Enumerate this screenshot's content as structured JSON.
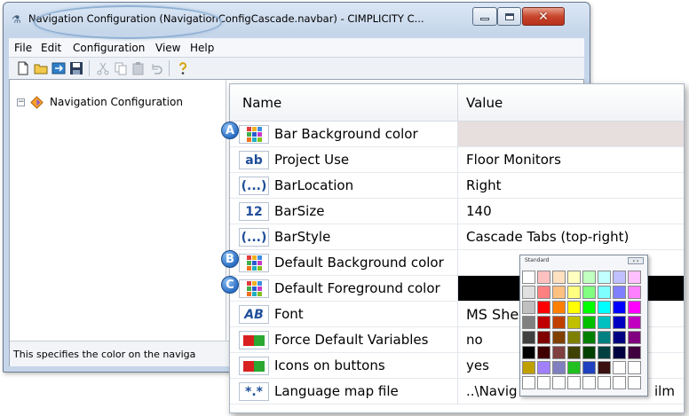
{
  "window": {
    "title": "Navigation Configuration (NavigationConfigCascade.navbar) - CIMPLICITY C...",
    "close_glyph": "✕"
  },
  "menu": [
    "File",
    "Edit",
    "Configuration",
    "View",
    "Help"
  ],
  "tree": {
    "expander": "−",
    "root_label": "Navigation Configuration"
  },
  "status": {
    "text": "This specifies the color on the naviga"
  },
  "grid": {
    "header_name": "Name",
    "header_value": "Value",
    "rows": [
      {
        "badge": "A",
        "icon": "color-grid-icon",
        "name": "Bar Background color",
        "value": "",
        "swatch": "#e7dede"
      },
      {
        "icon": "text-ab-icon",
        "icon_text": "ab",
        "name": "Project Use",
        "value": "Floor Monitors"
      },
      {
        "icon": "ellipsis-icon",
        "icon_text": "(...)",
        "name": "BarLocation",
        "value": "Right"
      },
      {
        "icon": "number-icon",
        "icon_text": "12",
        "name": "BarSize",
        "value": "140"
      },
      {
        "icon": "ellipsis-icon",
        "icon_text": "(...)",
        "name": "BarStyle",
        "value": "Cascade Tabs (top-right)"
      },
      {
        "badge": "B",
        "icon": "color-grid-icon",
        "name": "Default Background color",
        "value": ""
      },
      {
        "badge": "C",
        "icon": "color-grid-icon",
        "name": "Default Foreground color",
        "value": "",
        "swatch": "#000000"
      },
      {
        "icon": "font-icon",
        "icon_text": "AB",
        "name": "Font",
        "value": "MS She"
      },
      {
        "icon": "toggle-icon",
        "name": "Force Default Variables",
        "value": "no"
      },
      {
        "icon": "toggle-icon",
        "name": "Icons on buttons",
        "value": "yes"
      },
      {
        "icon": "file-icon",
        "icon_text": "*.*",
        "name": "Language map file",
        "value": "..\\Navig",
        "value_tail": "ilm"
      }
    ]
  },
  "picker": {
    "title": "Standard",
    "nav": "‹ ›",
    "colors": [
      "#ffffff",
      "#ffc0c0",
      "#ffe0c0",
      "#ffffc0",
      "#c0ffc0",
      "#c0ffff",
      "#c0c0ff",
      "#ffc0ff",
      "#e0e0e0",
      "#ff8080",
      "#ffc080",
      "#ffff80",
      "#80ff80",
      "#80ffff",
      "#8080ff",
      "#ff80ff",
      "#c0c0c0",
      "#ff0000",
      "#ff8000",
      "#ffff00",
      "#00ff00",
      "#00ffff",
      "#0000ff",
      "#ff00ff",
      "#808080",
      "#c00000",
      "#c04000",
      "#c0c000",
      "#00c000",
      "#00c0c0",
      "#0000c0",
      "#c000c0",
      "#404040",
      "#800000",
      "#804000",
      "#808000",
      "#008000",
      "#008080",
      "#000080",
      "#800080",
      "#000000",
      "#400000",
      "#804040",
      "#404000",
      "#004000",
      "#004040",
      "#000040",
      "#400040",
      "#c0a000",
      "#a080ff",
      "#8080c0",
      "#20c020",
      "#2040c0",
      "#3a1010",
      "#ffffff",
      "#ffffff",
      "#ffffff",
      "#ffffff",
      "#ffffff",
      "#ffffff",
      "#ffffff",
      "#ffffff",
      "#ffffff",
      "#ffffff"
    ]
  },
  "colors": {
    "window_frame": "#c6d6ea",
    "badge_blue": "#2b6fc4",
    "icon_blue": "#1f4f9a"
  }
}
